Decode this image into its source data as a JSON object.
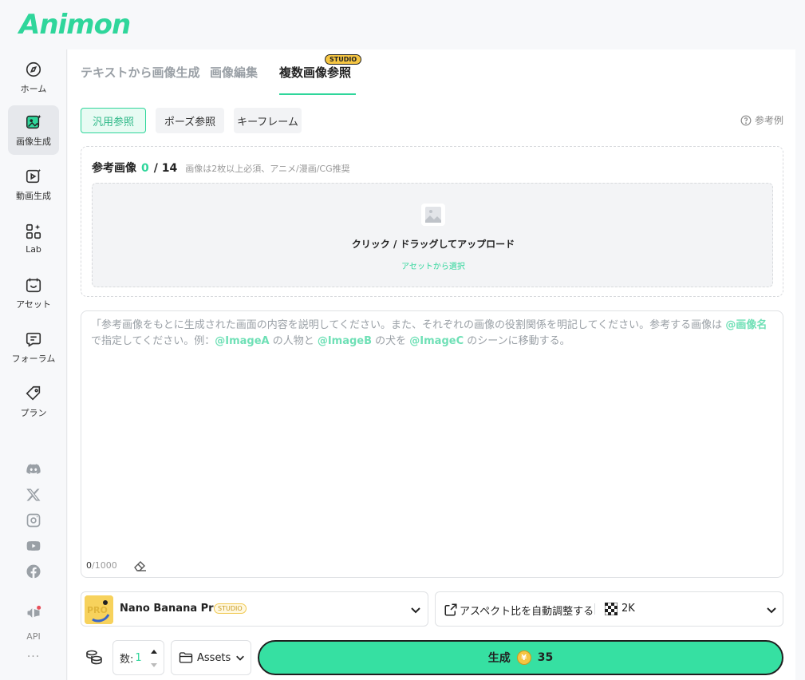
{
  "app": {
    "logo": "Animon"
  },
  "sidebar": {
    "items": [
      {
        "label": "ホーム",
        "icon": "compass-icon"
      },
      {
        "label": "画像生成",
        "icon": "image-generate-icon"
      },
      {
        "label": "動画生成",
        "icon": "video-generate-icon"
      },
      {
        "label": "Lab",
        "icon": "grid-sparkle-icon"
      },
      {
        "label": "アセット",
        "icon": "asset-icon"
      },
      {
        "label": "フォーラム",
        "icon": "chat-icon"
      },
      {
        "label": "プラン",
        "icon": "tag-icon"
      }
    ],
    "api_label": "API",
    "more": "···"
  },
  "tabs": [
    {
      "label": "テキストから画像生成"
    },
    {
      "label": "画像編集"
    },
    {
      "label": "複数画像参照",
      "badge": "STUDIO"
    }
  ],
  "mode_pills": [
    {
      "label": "汎用参照"
    },
    {
      "label": "ポーズ参照"
    },
    {
      "label": "キーフレーム"
    }
  ],
  "examples_label": "参考例",
  "reference": {
    "title": "参考画像",
    "count": "0",
    "max": "/ 14",
    "hint": "画像は2枚以上必須、アニメ/漫画/CG推奨",
    "upload_text": "クリック / ドラッグしてアップロード",
    "asset_link": "アセットから選択"
  },
  "prompt": {
    "part1": "「参考画像をもとに生成された画面の内容を説明してください。また、それぞれの画像の役割関係を明記してください。参考する画像は ",
    "at1": "@画像名",
    "part2": " で指定してください。例：",
    "at2": "@ImageA",
    "part3": " の人物と ",
    "at3": "@ImageB",
    "part4": " の犬を ",
    "at4": "@ImageC",
    "part5": " のシーンに移動する。",
    "count": "0",
    "max": "/1000"
  },
  "model": {
    "name": "Nano Banana Pro",
    "badge": "STUDIO"
  },
  "aspect": {
    "label": "アスペクト比を自動調整する",
    "resolution": "2K"
  },
  "bottom": {
    "count_label": "数:",
    "count_value": "1",
    "assets_label": "Assets",
    "generate_label": "生成",
    "cost": "35"
  },
  "colors": {
    "accent": "#2fd69b",
    "button": "#36e0a2",
    "studio": "#f5c542"
  }
}
